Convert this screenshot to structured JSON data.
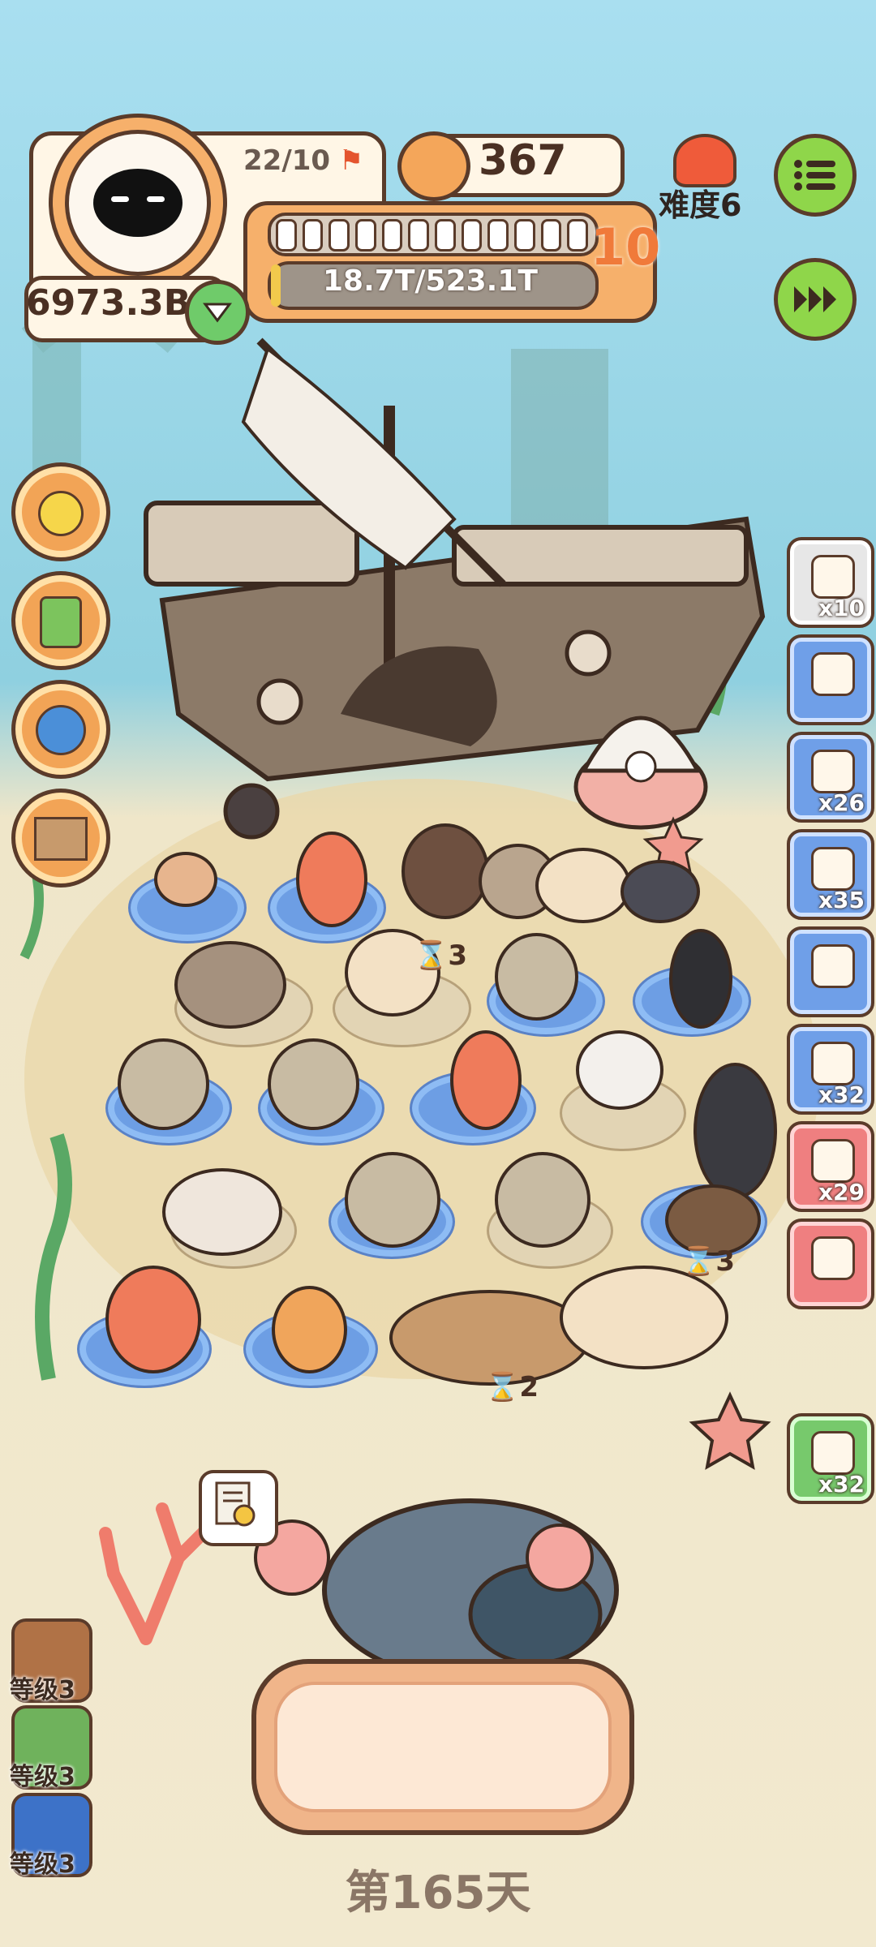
{
  "hud": {
    "level_progress": "22/10",
    "coins": "367",
    "difficulty": "难度6",
    "money": "6973.3B",
    "exp_text": "18.7T/523.1T",
    "level_number": "10",
    "level_segments_filled": 12,
    "level_segments_total": 12
  },
  "side_items": [
    {
      "icon": "fishing-float-icon",
      "count": "x10"
    },
    {
      "icon": "treasure-chest-icon",
      "count": ""
    },
    {
      "icon": "flying-fish-icon",
      "count": "x26"
    },
    {
      "icon": "oxygen-tank-icon",
      "count": "x35"
    },
    {
      "icon": "mole-toy-icon",
      "count": ""
    },
    {
      "icon": "scuba-mask-icon",
      "count": "x32"
    },
    {
      "icon": "snorkel-mask-icon",
      "count": "x29"
    },
    {
      "icon": "heart-creature-icon",
      "count": ""
    },
    {
      "icon": "shower-head-icon",
      "count": "x32"
    }
  ],
  "timers": [
    "3",
    "3",
    "2"
  ],
  "levels": [
    {
      "label": "等级3",
      "color": "#b07246"
    },
    {
      "label": "等级3",
      "color": "#6fb25c"
    },
    {
      "label": "等级3",
      "color": "#3d72c8"
    }
  ],
  "day": "第165天",
  "colors": {
    "ocean_top": "#a9dff0",
    "sand": "#efe6c9",
    "accent_orange": "#f2a456",
    "menu_green": "#8fd64a"
  }
}
